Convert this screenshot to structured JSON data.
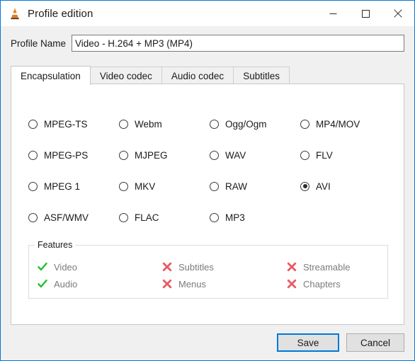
{
  "window": {
    "title": "Profile edition",
    "app_icon": "vlc-cone-icon",
    "accent_color": "#0078d7",
    "controls": {
      "minimize": "minimize-icon",
      "maximize": "maximize-icon",
      "close": "close-icon"
    }
  },
  "profile": {
    "label": "Profile Name",
    "value": "Video - H.264 + MP3 (MP4)",
    "placeholder": "Profile Name"
  },
  "tabs": [
    {
      "label": "Encapsulation",
      "selected": true
    },
    {
      "label": "Video codec",
      "selected": false
    },
    {
      "label": "Audio codec",
      "selected": false
    },
    {
      "label": "Subtitles",
      "selected": false
    }
  ],
  "encapsulation": {
    "rows": [
      [
        {
          "label": "MPEG-TS",
          "selected": false
        },
        {
          "label": "Webm",
          "selected": false
        },
        {
          "label": "Ogg/Ogm",
          "selected": false
        },
        {
          "label": "MP4/MOV",
          "selected": false
        }
      ],
      [
        {
          "label": "MPEG-PS",
          "selected": false
        },
        {
          "label": "MJPEG",
          "selected": false
        },
        {
          "label": "WAV",
          "selected": false
        },
        {
          "label": "FLV",
          "selected": false
        }
      ],
      [
        {
          "label": "MPEG 1",
          "selected": false
        },
        {
          "label": "MKV",
          "selected": false
        },
        {
          "label": "RAW",
          "selected": false
        },
        {
          "label": "AVI",
          "selected": true
        }
      ],
      [
        {
          "label": "ASF/WMV",
          "selected": false
        },
        {
          "label": "FLAC",
          "selected": false
        },
        {
          "label": "MP3",
          "selected": false
        }
      ]
    ]
  },
  "features": {
    "legend": "Features",
    "check_color": "#22c032",
    "cross_color": "#ea5a62",
    "rows": [
      [
        {
          "label": "Video",
          "state": "yes",
          "icon": "check-icon"
        },
        {
          "label": "Subtitles",
          "state": "no",
          "icon": "cross-icon"
        },
        {
          "label": "Streamable",
          "state": "no",
          "icon": "cross-icon"
        }
      ],
      [
        {
          "label": "Audio",
          "state": "yes",
          "icon": "check-icon"
        },
        {
          "label": "Menus",
          "state": "no",
          "icon": "cross-icon"
        },
        {
          "label": "Chapters",
          "state": "no",
          "icon": "cross-icon"
        }
      ]
    ]
  },
  "buttons": {
    "save": "Save",
    "cancel": "Cancel"
  }
}
